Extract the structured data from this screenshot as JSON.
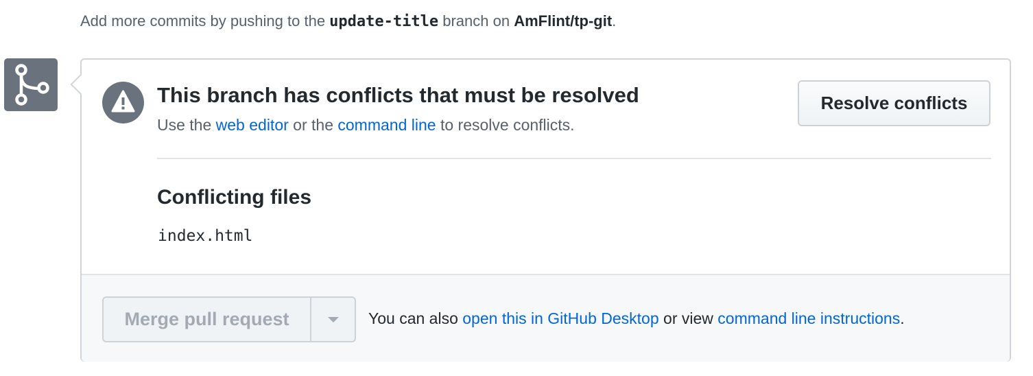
{
  "intro": {
    "prefix": "Add more commits by pushing to the ",
    "branch": "update-title",
    "middle": " branch on ",
    "repo": "AmFlint/tp-git",
    "suffix": "."
  },
  "conflict": {
    "title": "This branch has conflicts that must be resolved",
    "subtitle_prefix": "Use the ",
    "web_editor_link": "web editor",
    "subtitle_middle": " or the ",
    "command_line_link": "command line",
    "subtitle_suffix": " to resolve conflicts.",
    "resolve_button": "Resolve conflicts"
  },
  "files": {
    "heading": "Conflicting files",
    "items": [
      "index.html"
    ]
  },
  "footer": {
    "merge_button": "Merge pull request",
    "text_prefix": "You can also ",
    "desktop_link": "open this in GitHub Desktop",
    "text_middle": " or view ",
    "instructions_link": "command line instructions",
    "text_suffix": "."
  },
  "icons": {
    "merge": "git-merge-icon",
    "alert": "alert-triangle-icon",
    "dropdown": "triangle-down-icon"
  },
  "colors": {
    "link": "#0366d6",
    "icon_bg": "#6a737d",
    "border": "#d1d5da",
    "footer_bg": "#f6f8fa",
    "disabled_text": "#a3aab1"
  }
}
